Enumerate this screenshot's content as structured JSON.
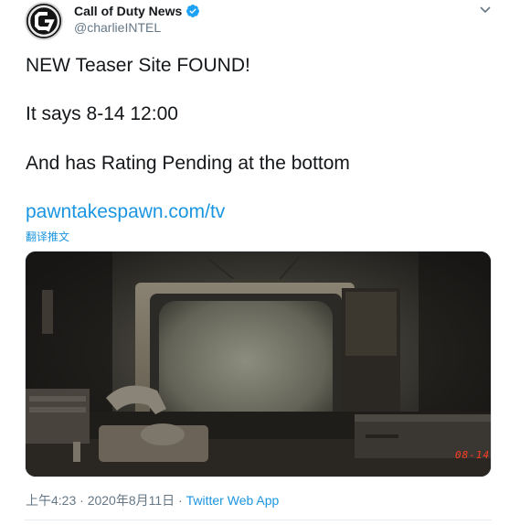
{
  "tweet": {
    "display_name": "Call of Duty News",
    "handle": "@charlieINTEL",
    "lines": [
      "NEW Teaser Site FOUND!",
      "It says 8-14 12:00",
      "And has Rating Pending at the bottom"
    ],
    "link_text": "pawntakespawn.com/tv",
    "translate_label": "翻译推文",
    "media": {
      "vcr_display": "08-14"
    },
    "timestamp": "上午4:23 · 2020年8月11日 · ",
    "source": "Twitter Web App"
  },
  "colors": {
    "link": "#1b95e0",
    "verified": "#1da1f2",
    "vcr_led": "#ff3b1f"
  },
  "icons": {
    "verified": "verified-badge-icon",
    "caret": "chevron-down-icon"
  }
}
